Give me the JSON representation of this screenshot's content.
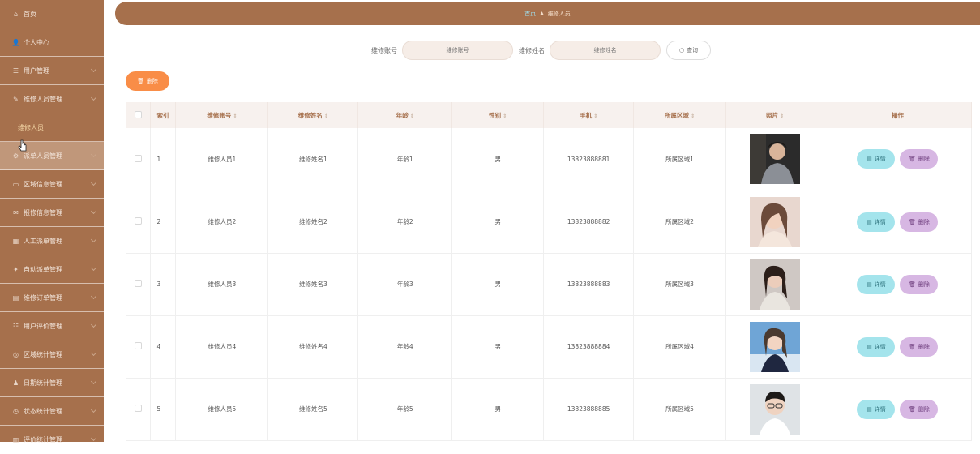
{
  "sidebar": {
    "items": [
      {
        "icon": "home-icon",
        "glyph": "⌂",
        "label": "首页"
      },
      {
        "icon": "user-icon",
        "glyph": "👤",
        "label": "个人中心",
        "chevron": false
      },
      {
        "icon": "users-icon",
        "glyph": "☰",
        "label": "用户管理",
        "chevron": true
      },
      {
        "icon": "tool-icon",
        "glyph": "✎",
        "label": "维修人员管理",
        "chevron": true
      },
      {
        "label": "维修人员",
        "sub": true
      },
      {
        "icon": "gear-icon",
        "glyph": "⚙",
        "label": "派单人员管理",
        "chevron": true,
        "hover": true
      },
      {
        "icon": "map-icon",
        "glyph": "▭",
        "label": "区域信息管理",
        "chevron": true
      },
      {
        "icon": "report-icon",
        "glyph": "✉",
        "label": "报修信息管理",
        "chevron": true
      },
      {
        "icon": "grid-icon",
        "glyph": "▦",
        "label": "人工派单管理",
        "chevron": true
      },
      {
        "icon": "auto-icon",
        "glyph": "✦",
        "label": "自动派单管理",
        "chevron": true
      },
      {
        "icon": "order-icon",
        "glyph": "▤",
        "label": "维修订单管理",
        "chevron": true
      },
      {
        "icon": "rating-icon",
        "glyph": "☷",
        "label": "用户评价管理",
        "chevron": true
      },
      {
        "icon": "region-stats-icon",
        "glyph": "◎",
        "label": "区域统计管理",
        "chevron": true
      },
      {
        "icon": "date-stats-icon",
        "glyph": "♟",
        "label": "日期统计管理",
        "chevron": true
      },
      {
        "icon": "status-stats-icon",
        "glyph": "◷",
        "label": "状态统计管理",
        "chevron": true
      },
      {
        "icon": "eval-stats-icon",
        "glyph": "▥",
        "label": "评价统计管理",
        "chevron": true
      }
    ]
  },
  "breadcrumb": {
    "home": "首页",
    "current": "维修人员"
  },
  "search": {
    "account_label": "维修账号",
    "account_placeholder": "维修账号",
    "name_label": "维修姓名",
    "name_placeholder": "维修姓名",
    "query_label": "查询"
  },
  "actions": {
    "delete_label": "删除"
  },
  "table": {
    "headers": {
      "index": "索引",
      "account": "维修账号",
      "name": "维修姓名",
      "age": "年龄",
      "gender": "性别",
      "phone": "手机",
      "region": "所属区域",
      "photo": "照片",
      "ops": "操作"
    },
    "detail_label": "详情",
    "delete_label": "删除",
    "rows": [
      {
        "index": "1",
        "account": "维修人员1",
        "name": "维修姓名1",
        "age": "年龄1",
        "gender": "男",
        "phone": "13823888881",
        "region": "所属区域1"
      },
      {
        "index": "2",
        "account": "维修人员2",
        "name": "维修姓名2",
        "age": "年龄2",
        "gender": "男",
        "phone": "13823888882",
        "region": "所属区域2"
      },
      {
        "index": "3",
        "account": "维修人员3",
        "name": "维修姓名3",
        "age": "年龄3",
        "gender": "男",
        "phone": "13823888883",
        "region": "所属区域3"
      },
      {
        "index": "4",
        "account": "维修人员4",
        "name": "维修姓名4",
        "age": "年龄4",
        "gender": "男",
        "phone": "13823888884",
        "region": "所属区域4"
      },
      {
        "index": "5",
        "account": "维修人员5",
        "name": "维修姓名5",
        "age": "年龄5",
        "gender": "男",
        "phone": "13823888885",
        "region": "所属区域5"
      }
    ]
  },
  "colors": {
    "sidebar": "#a6704c",
    "accent_orange": "#f98d47",
    "detail": "#a4e4ec",
    "delete": "#d7b7e3"
  }
}
